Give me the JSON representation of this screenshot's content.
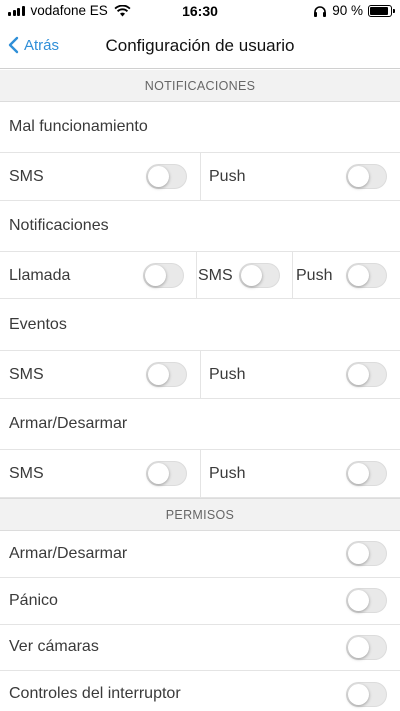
{
  "status_bar": {
    "carrier": "vodafone ES",
    "time": "16:30",
    "battery_text": "90 %",
    "battery_level": 0.9
  },
  "nav": {
    "back_label": "Atrás",
    "title": "Configuración de usuario"
  },
  "notificaciones": {
    "header": "NOTIFICACIONES",
    "mal_funcionamiento": {
      "title": "Mal funcionamiento",
      "sms_label": "SMS",
      "sms_on": false,
      "push_label": "Push",
      "push_on": false
    },
    "notificaciones": {
      "title": "Notificaciones",
      "call_label": "Llamada",
      "call_on": false,
      "sms_label": "SMS",
      "sms_on": false,
      "push_label": "Push",
      "push_on": false
    },
    "eventos": {
      "title": "Eventos",
      "sms_label": "SMS",
      "sms_on": false,
      "push_label": "Push",
      "push_on": false
    },
    "armar_desarmar": {
      "title": "Armar/Desarmar",
      "sms_label": "SMS",
      "sms_on": false,
      "push_label": "Push",
      "push_on": false
    }
  },
  "permisos": {
    "header": "PERMISOS",
    "items": [
      {
        "label": "Armar/Desarmar",
        "on": false
      },
      {
        "label": "Pánico",
        "on": false
      },
      {
        "label": "Ver cámaras",
        "on": false
      },
      {
        "label": "Controles del interruptor",
        "on": false
      }
    ]
  }
}
